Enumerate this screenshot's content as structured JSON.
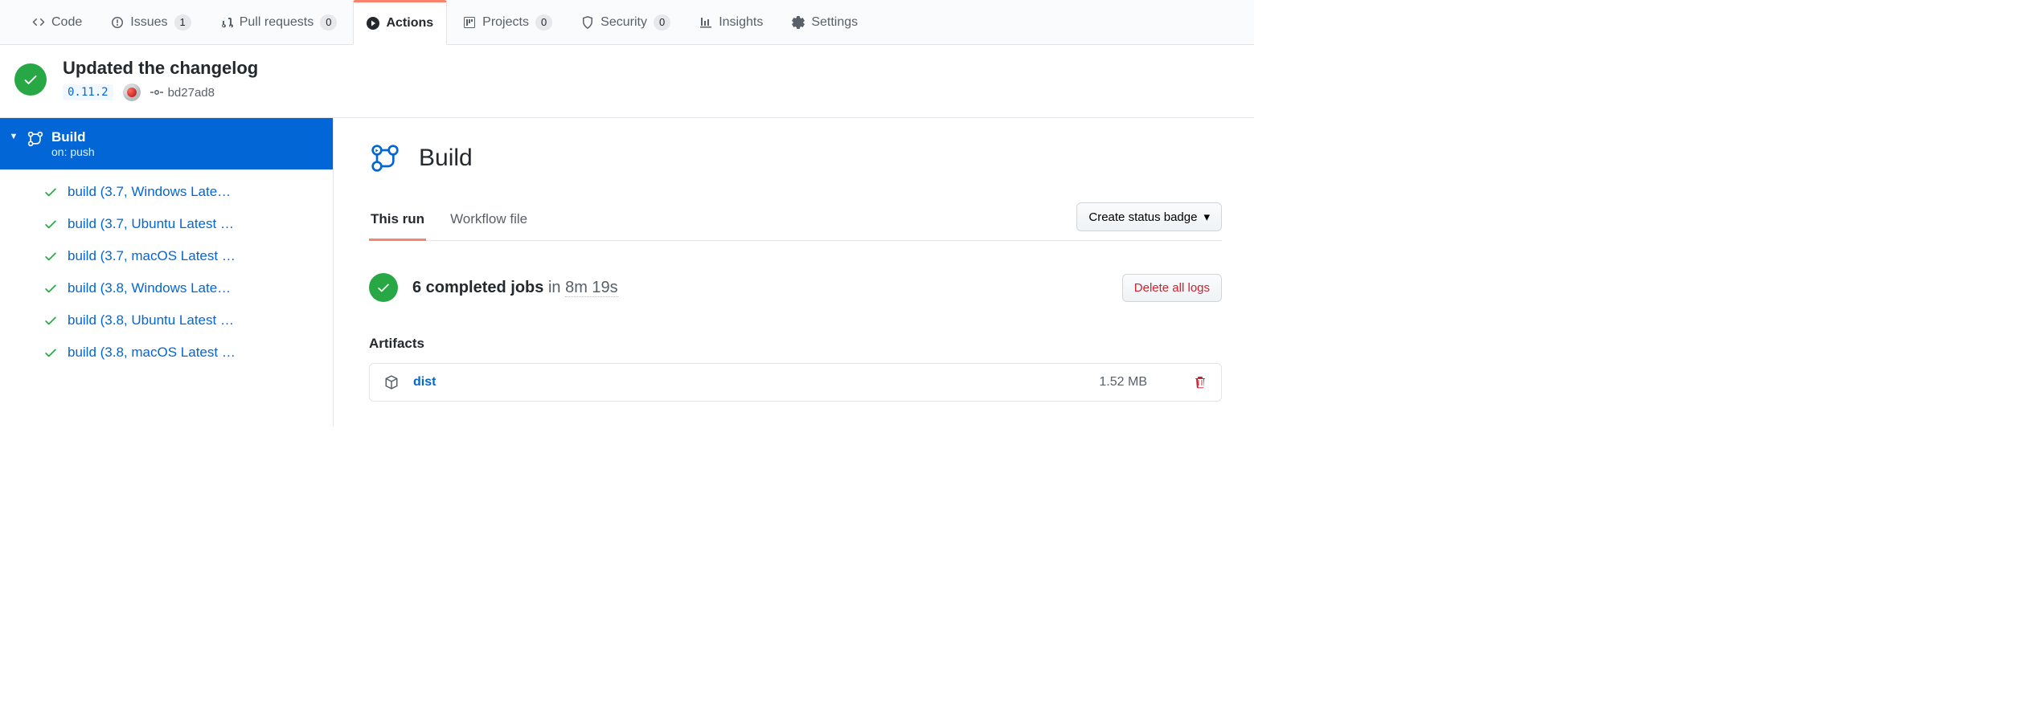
{
  "repo_tabs": {
    "code": "Code",
    "issues": "Issues",
    "issues_count": "1",
    "pulls": "Pull requests",
    "pulls_count": "0",
    "actions": "Actions",
    "projects": "Projects",
    "projects_count": "0",
    "security": "Security",
    "security_count": "0",
    "insights": "Insights",
    "settings": "Settings"
  },
  "run": {
    "title": "Updated the changelog",
    "tag": "0.11.2",
    "sha": "bd27ad8"
  },
  "workflow": {
    "name": "Build",
    "trigger": "on: push"
  },
  "jobs": [
    {
      "name": "build (3.7, Windows Late…"
    },
    {
      "name": "build (3.7, Ubuntu Latest …"
    },
    {
      "name": "build (3.7, macOS Latest …"
    },
    {
      "name": "build (3.8, Windows Late…"
    },
    {
      "name": "build (3.8, Ubuntu Latest …"
    },
    {
      "name": "build (3.8, macOS Latest …"
    }
  ],
  "pane": {
    "title": "Build",
    "tabs": {
      "this_run": "This run",
      "workflow_file": "Workflow file"
    },
    "status_badge_btn": "Create status badge",
    "summary_jobs": "6 completed jobs",
    "summary_in": "in",
    "summary_duration": "8m 19s",
    "delete_logs_btn": "Delete all logs",
    "artifacts_label": "Artifacts"
  },
  "artifacts": [
    {
      "name": "dist",
      "size": "1.52 MB"
    }
  ]
}
